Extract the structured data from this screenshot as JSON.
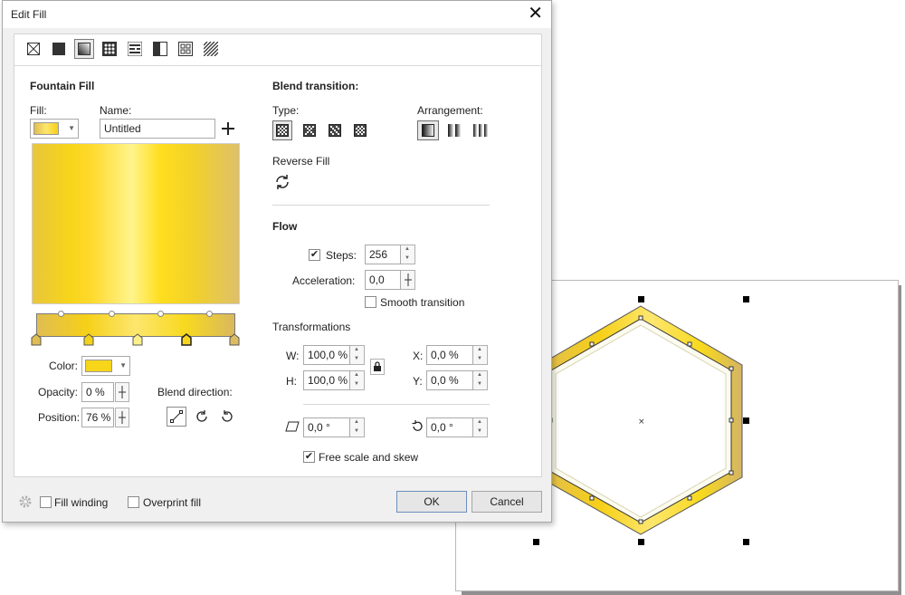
{
  "dialog": {
    "title": "Edit Fill"
  },
  "fill_types": [
    {
      "name": "no-fill",
      "selected": false
    },
    {
      "name": "uniform-fill",
      "selected": false
    },
    {
      "name": "fountain-fill",
      "selected": true
    },
    {
      "name": "vector-pattern-fill",
      "selected": false
    },
    {
      "name": "bitmap-pattern-fill",
      "selected": false
    },
    {
      "name": "two-color-pattern-fill",
      "selected": false
    },
    {
      "name": "texture-fill",
      "selected": false
    },
    {
      "name": "postscript-fill",
      "selected": false
    }
  ],
  "left": {
    "section_title": "Fountain Fill",
    "fill_label": "Fill:",
    "name_label": "Name:",
    "name_value": "Untitled",
    "color_label": "Color:",
    "color_value": "#f7d51b",
    "opacity_label": "Opacity:",
    "opacity_value": "0 %",
    "position_label": "Position:",
    "position_value": "76 %",
    "blend_direction_label": "Blend direction:"
  },
  "right": {
    "blend_title": "Blend transition:",
    "type_label": "Type:",
    "arrangement_label": "Arrangement:",
    "reverse_label": "Reverse Fill",
    "flow_title": "Flow",
    "steps_label": "Steps:",
    "steps_checked": true,
    "steps_value": "256",
    "accel_label": "Acceleration:",
    "accel_value": "0,0",
    "smooth_label": "Smooth transition",
    "smooth_checked": false,
    "transformations_title": "Transformations",
    "w_label": "W:",
    "w_value": "100,0 %",
    "h_label": "H:",
    "h_value": "100,0 %",
    "x_label": "X:",
    "x_value": "0,0 %",
    "y_label": "Y:",
    "y_value": "0,0 %",
    "skew_value": "0,0 °",
    "rotate_value": "0,0 °",
    "free_scale_label": "Free scale and skew",
    "free_scale_checked": true
  },
  "footer": {
    "fill_winding_label": "Fill winding",
    "overprint_label": "Overprint fill",
    "ok_label": "OK",
    "cancel_label": "Cancel"
  },
  "colors": {
    "gold_dark": "#e0bd52",
    "gold_mid": "#f7d51b",
    "gold_light": "#fff48c"
  }
}
